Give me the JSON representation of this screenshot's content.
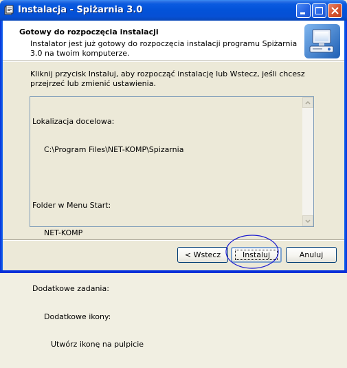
{
  "window": {
    "title": "Instalacja - Spiżarnia 3.0"
  },
  "header": {
    "title": "Gotowy do rozpoczęcia instalacji",
    "description": "Instalator jest już gotowy do rozpoczęcia instalacji programu Spiżarnia 3.0 na twoim komputerze."
  },
  "instruction": "Kliknij przycisk Instaluj, aby rozpocząć instalację lub Wstecz, jeśli chcesz przejrzeć lub zmienić ustawienia.",
  "memo": {
    "lines": [
      "Lokalizacja docelowa:",
      "C:\\Program Files\\NET-KOMP\\Spizarnia",
      "",
      "Folder w Menu Start:",
      "NET-KOMP",
      "",
      "Dodatkowe zadania:",
      "Dodatkowe ikony:",
      "Utwórz ikonę na pulpicie"
    ]
  },
  "buttons": {
    "back": "< Wstecz",
    "install": "Instaluj",
    "cancel": "Anuluj"
  },
  "icons": {
    "title": "setup-icon",
    "header": "computer-install-icon",
    "minimize": "minimize-icon",
    "maximize": "maximize-icon",
    "close": "close-icon"
  },
  "colors": {
    "titlebar": "#0352d8",
    "annotation": "#1a1ad0"
  }
}
